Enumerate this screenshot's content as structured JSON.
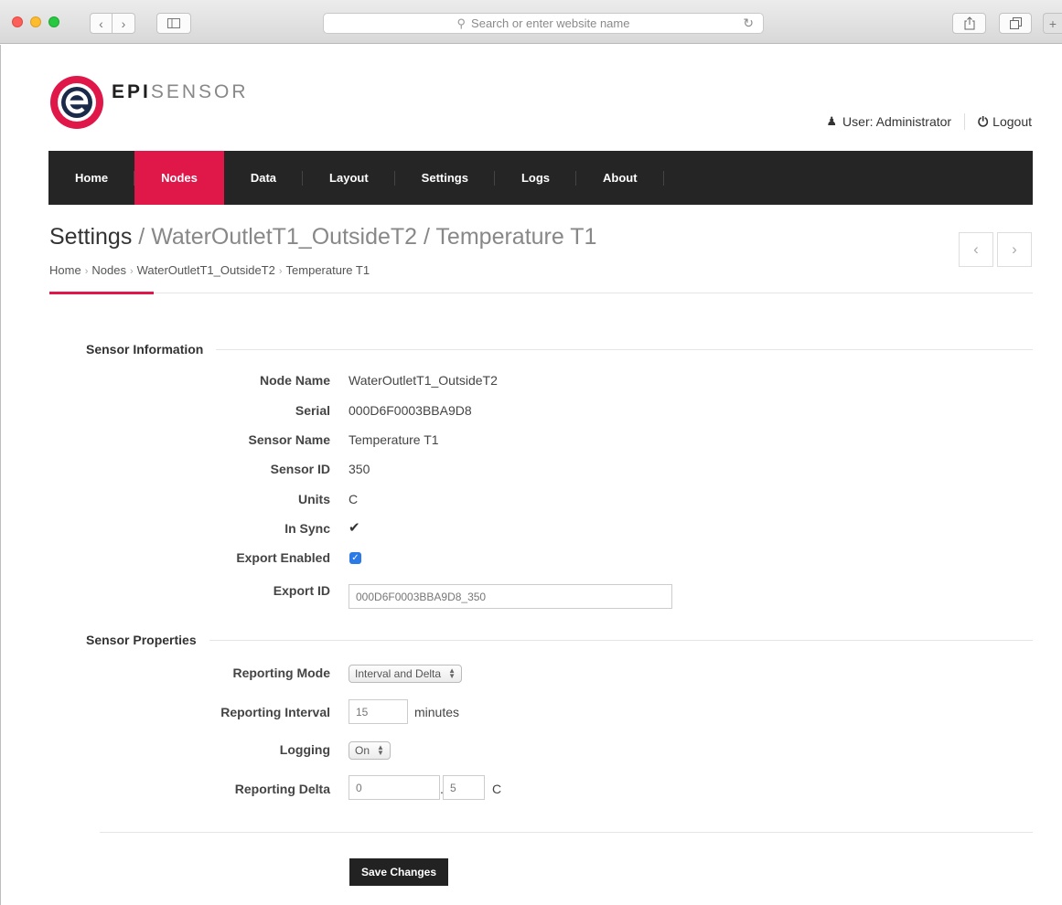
{
  "browser": {
    "search_placeholder": "Search or enter website name"
  },
  "brand": {
    "epi": "EPI",
    "sensor": "SENSOR",
    "accent_color": "#e0184a"
  },
  "user": {
    "label": "User: Administrator",
    "logout": "Logout"
  },
  "nav": {
    "items": [
      {
        "label": "Home"
      },
      {
        "label": "Nodes",
        "active": true
      },
      {
        "label": "Data"
      },
      {
        "label": "Layout"
      },
      {
        "label": "Settings"
      },
      {
        "label": "Logs"
      },
      {
        "label": "About"
      }
    ]
  },
  "title": {
    "main": "Settings",
    "rest": "/ WaterOutletT1_OutsideT2 / Temperature T1"
  },
  "breadcrumb": [
    "Home",
    "Nodes",
    "WaterOutletT1_OutsideT2",
    "Temperature T1"
  ],
  "sensor_info": {
    "heading": "Sensor Information",
    "node_name_label": "Node Name",
    "node_name": "WaterOutletT1_OutsideT2",
    "serial_label": "Serial",
    "serial": "000D6F0003BBA9D8",
    "sensor_name_label": "Sensor Name",
    "sensor_name": "Temperature T1",
    "sensor_id_label": "Sensor ID",
    "sensor_id": "350",
    "units_label": "Units",
    "units": "C",
    "in_sync_label": "In Sync",
    "export_enabled_label": "Export Enabled",
    "export_id_label": "Export ID",
    "export_id": "000D6F0003BBA9D8_350"
  },
  "sensor_props": {
    "heading": "Sensor Properties",
    "reporting_mode_label": "Reporting Mode",
    "reporting_mode": "Interval and Delta",
    "reporting_interval_label": "Reporting Interval",
    "reporting_interval": "15",
    "interval_unit": "minutes",
    "logging_label": "Logging",
    "logging": "On",
    "reporting_delta_label": "Reporting Delta",
    "delta_int": "0",
    "delta_frac": "5",
    "delta_unit": "C"
  },
  "actions": {
    "save": "Save Changes"
  }
}
